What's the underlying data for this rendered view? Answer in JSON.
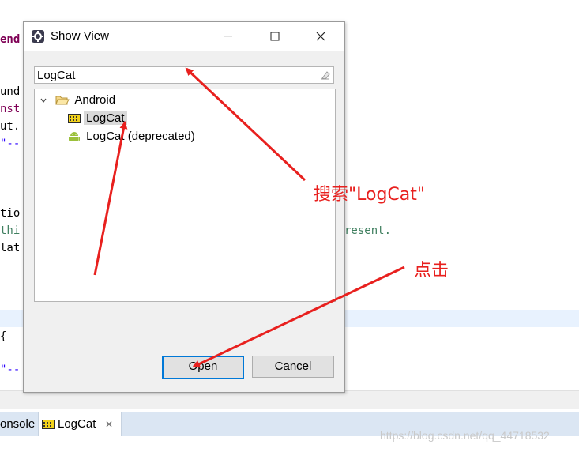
{
  "editor": {
    "lines": [
      {
        "text": "end",
        "style": "kw"
      },
      {
        "text": "und",
        "style": ""
      },
      {
        "text": "nst",
        "style": "kw"
      },
      {
        "text": "ut.",
        "style": ""
      },
      {
        "text": "\"--",
        "style": "st"
      },
      {
        "text": "tio",
        "style": ""
      },
      {
        "text": "thi",
        "style": "cm"
      },
      {
        "text": "lat",
        "style": ""
      },
      {
        "text": "{",
        "style": ""
      },
      {
        "text": "\"--",
        "style": "st"
      }
    ],
    "right_fragment": "resent."
  },
  "dialog": {
    "title": "Show View",
    "search_value": "LogCat",
    "tree": {
      "group": "Android",
      "items": [
        "LogCat",
        "LogCat (deprecated)"
      ]
    },
    "buttons": {
      "open": "Open",
      "cancel": "Cancel"
    }
  },
  "tabs": {
    "console": "onsole",
    "logcat": "LogCat",
    "close_glyph": "✕"
  },
  "watermark": "https://blog.csdn.net/qq_44718532",
  "annotations": {
    "search_note": "搜索\"LogCat\"",
    "click_note": "点击",
    "color": "#e8201e"
  }
}
